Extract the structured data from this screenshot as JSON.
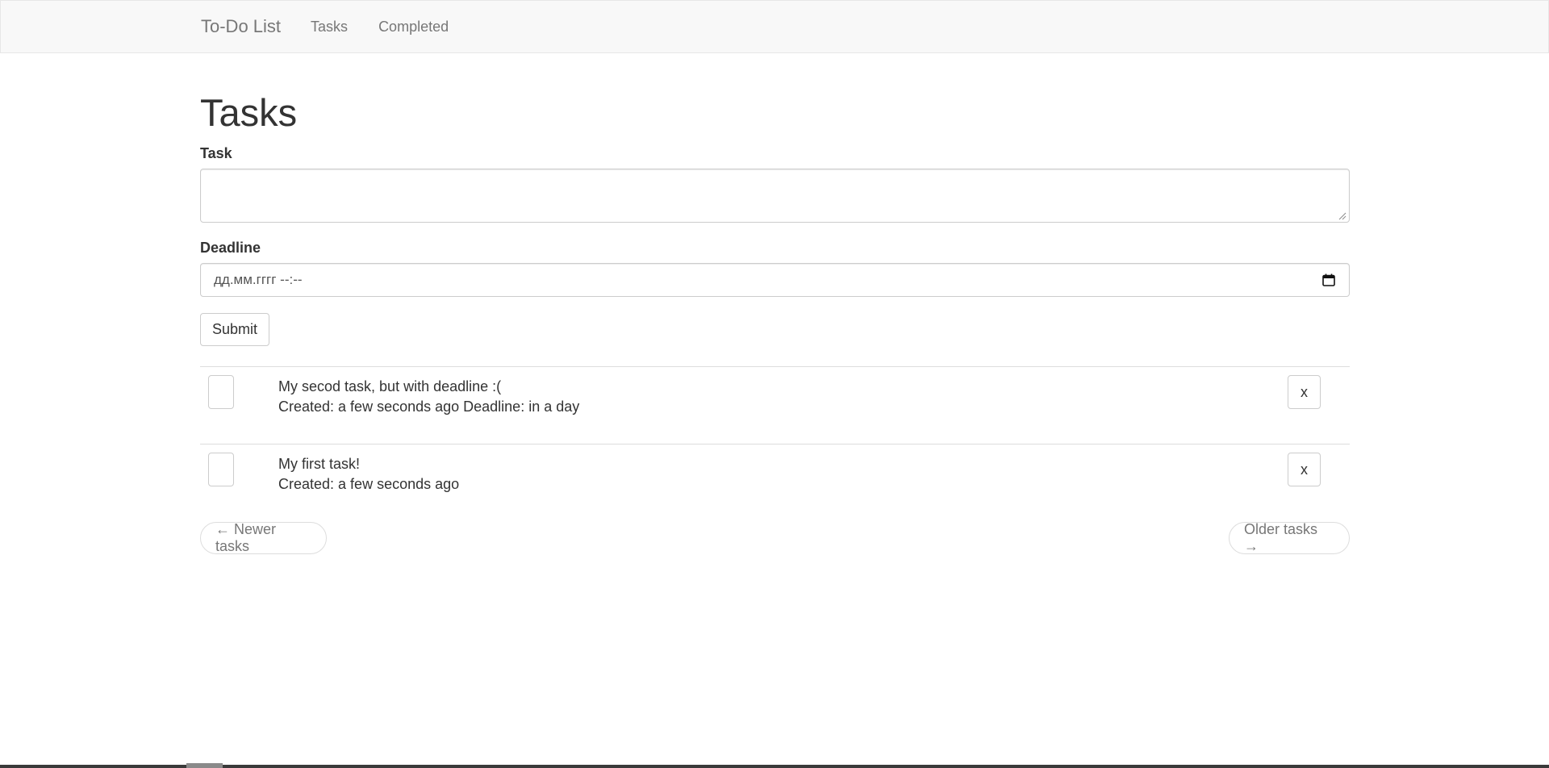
{
  "navbar": {
    "brand": "To-Do List",
    "links": [
      {
        "label": "Tasks"
      },
      {
        "label": "Completed"
      }
    ]
  },
  "page": {
    "title": "Tasks"
  },
  "form": {
    "task_label": "Task",
    "task_value": "",
    "deadline_label": "Deadline",
    "deadline_placeholder": "дд.мм.гггг --:--",
    "submit_label": "Submit"
  },
  "tasks": [
    {
      "title": "My secod task, but with deadline :(",
      "meta": "Created: a few seconds ago Deadline: in a day",
      "delete_label": "x"
    },
    {
      "title": "My first task!",
      "meta": "Created: a few seconds ago",
      "delete_label": "x"
    }
  ],
  "pager": {
    "newer_label": "← Newer tasks",
    "older_label": "Older tasks →"
  },
  "colors": {
    "navbar_bg": "#f8f8f8",
    "text": "#333333",
    "muted": "#777777",
    "border": "#cccccc"
  },
  "icons": {
    "calendar": "calendar-icon",
    "resize": "resize-grip-icon"
  }
}
